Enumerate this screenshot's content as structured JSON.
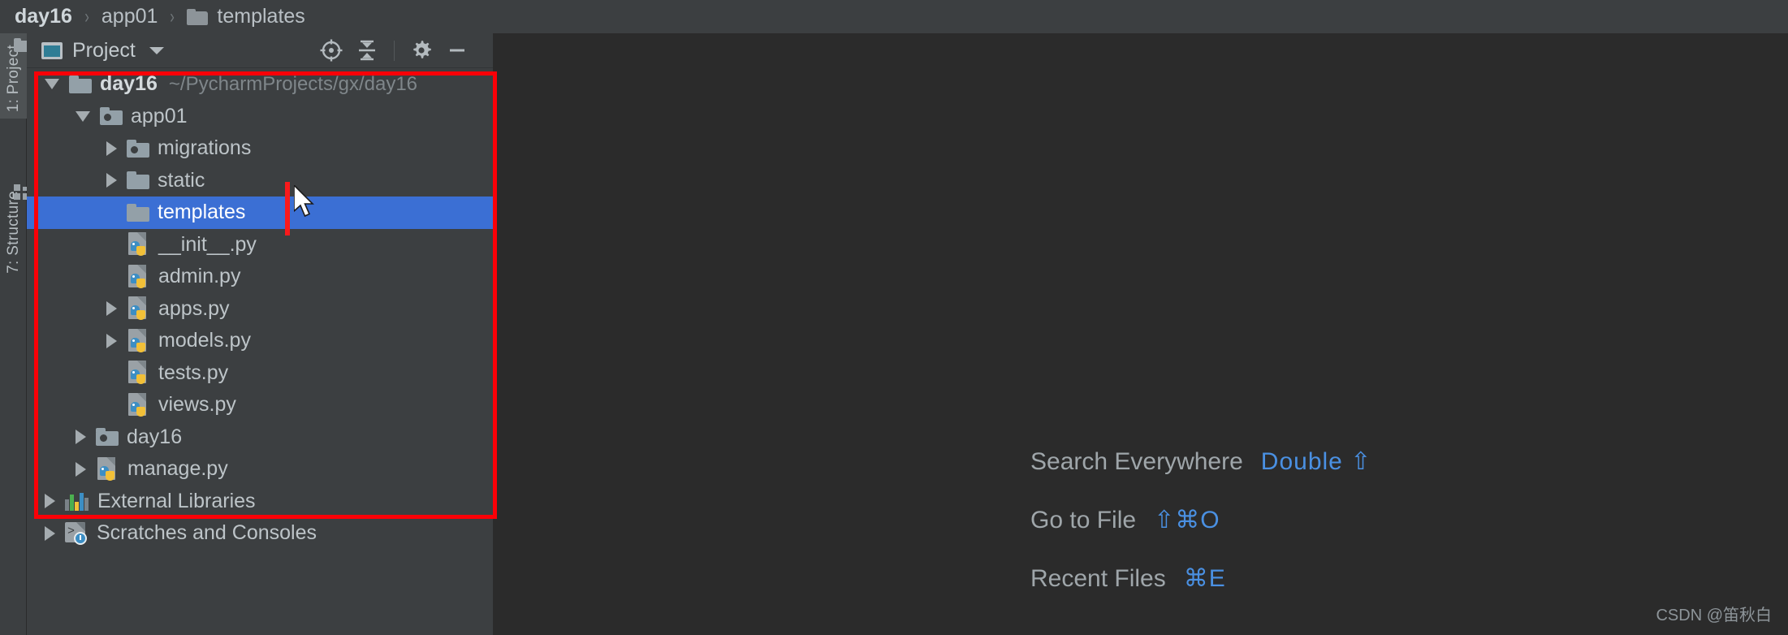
{
  "breadcrumb": {
    "items": [
      {
        "label": "day16",
        "bold": true,
        "icon": null
      },
      {
        "label": "app01",
        "bold": false,
        "icon": null
      },
      {
        "label": "templates",
        "bold": false,
        "icon": "folder-icon"
      }
    ],
    "separator": "›"
  },
  "toolstrip": {
    "buttons": [
      {
        "label": "1: Project",
        "icon": "folder-icon",
        "active": true
      },
      {
        "label": "7: Structure",
        "icon": "grid-icon",
        "active": false
      }
    ]
  },
  "panel": {
    "title": "Project",
    "dropdown_icon": "chevron-down-icon",
    "panel_icon": "project-view-icon",
    "actions": [
      {
        "name": "select-opened-file-icon",
        "title": "Select Opened File"
      },
      {
        "name": "collapse-all-icon",
        "title": "Collapse All"
      },
      {
        "name": "gear-icon",
        "title": "Settings"
      },
      {
        "name": "minimize-icon",
        "title": "Hide"
      }
    ]
  },
  "tree": {
    "rows": [
      {
        "label": "day16",
        "path": "~/PycharmProjects/gx/day16",
        "icon": "folder",
        "indent": 0,
        "arrow": "open",
        "bold": true,
        "selected": false
      },
      {
        "label": "app01",
        "path": "",
        "icon": "module-folder",
        "indent": 1,
        "arrow": "open",
        "bold": false,
        "selected": false
      },
      {
        "label": "migrations",
        "path": "",
        "icon": "module-folder",
        "indent": 2,
        "arrow": "closed",
        "bold": false,
        "selected": false
      },
      {
        "label": "static",
        "path": "",
        "icon": "folder",
        "indent": 2,
        "arrow": "closed",
        "bold": false,
        "selected": false
      },
      {
        "label": "templates",
        "path": "",
        "icon": "folder",
        "indent": 2,
        "arrow": "none",
        "bold": false,
        "selected": true
      },
      {
        "label": "__init__.py",
        "path": "",
        "icon": "python",
        "indent": 2,
        "arrow": "none",
        "bold": false,
        "selected": false
      },
      {
        "label": "admin.py",
        "path": "",
        "icon": "python",
        "indent": 2,
        "arrow": "none",
        "bold": false,
        "selected": false
      },
      {
        "label": "apps.py",
        "path": "",
        "icon": "python",
        "indent": 2,
        "arrow": "closed",
        "bold": false,
        "selected": false
      },
      {
        "label": "models.py",
        "path": "",
        "icon": "python",
        "indent": 2,
        "arrow": "closed",
        "bold": false,
        "selected": false
      },
      {
        "label": "tests.py",
        "path": "",
        "icon": "python",
        "indent": 2,
        "arrow": "none",
        "bold": false,
        "selected": false
      },
      {
        "label": "views.py",
        "path": "",
        "icon": "python",
        "indent": 2,
        "arrow": "none",
        "bold": false,
        "selected": false
      },
      {
        "label": "day16",
        "path": "",
        "icon": "module-folder",
        "indent": 1,
        "arrow": "closed",
        "bold": false,
        "selected": false
      },
      {
        "label": "manage.py",
        "path": "",
        "icon": "python",
        "indent": 1,
        "arrow": "closed",
        "bold": false,
        "selected": false
      },
      {
        "label": "External Libraries",
        "path": "",
        "icon": "library",
        "indent": 0,
        "arrow": "closed",
        "bold": false,
        "selected": false
      },
      {
        "label": "Scratches and Consoles",
        "path": "",
        "icon": "scratch",
        "indent": 0,
        "arrow": "closed",
        "bold": false,
        "selected": false
      }
    ]
  },
  "editor": {
    "shortcuts": [
      {
        "action": "Search Everywhere",
        "keys": "Double ⇧"
      },
      {
        "action": "Go to File",
        "keys": "⇧⌘O"
      },
      {
        "action": "Recent Files",
        "keys": "⌘E"
      }
    ]
  },
  "watermark": "CSDN @笛秋白",
  "colors": {
    "selection_blue": "#3b6fd4",
    "annotation_red": "#fb0007",
    "shortcut_blue": "#4a90e2",
    "panel_bg": "#3c3f41",
    "editor_bg": "#2b2b2b"
  }
}
